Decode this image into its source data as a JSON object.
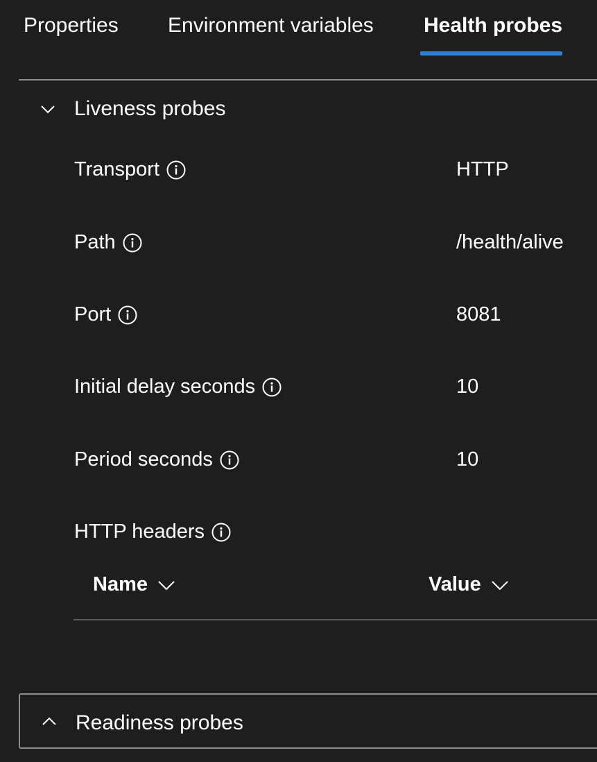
{
  "tabs": [
    {
      "label": "Properties",
      "selected": false
    },
    {
      "label": "Environment variables",
      "selected": false
    },
    {
      "label": "Health probes",
      "selected": true
    }
  ],
  "accent_color": "#2f80d9",
  "liveness": {
    "title": "Liveness probes",
    "expanded": true,
    "chevron_icon": "chevron-down-icon",
    "properties": [
      {
        "label": "Transport",
        "value": "HTTP",
        "icon": "info-icon"
      },
      {
        "label": "Path",
        "value": "/health/alive",
        "icon": "info-icon"
      },
      {
        "label": "Port",
        "value": "8081",
        "icon": "info-icon"
      },
      {
        "label": "Initial delay seconds",
        "value": "10",
        "icon": "info-icon"
      },
      {
        "label": "Period seconds",
        "value": "10",
        "icon": "info-icon"
      }
    ],
    "http_headers": {
      "label": "HTTP headers",
      "columns": [
        {
          "label": "Name",
          "icon": "chevron-down-icon"
        },
        {
          "label": "Value",
          "icon": "chevron-down-icon"
        }
      ],
      "rows": []
    }
  },
  "readiness": {
    "title": "Readiness probes",
    "expanded": false,
    "chevron_icon": "chevron-up-icon"
  }
}
